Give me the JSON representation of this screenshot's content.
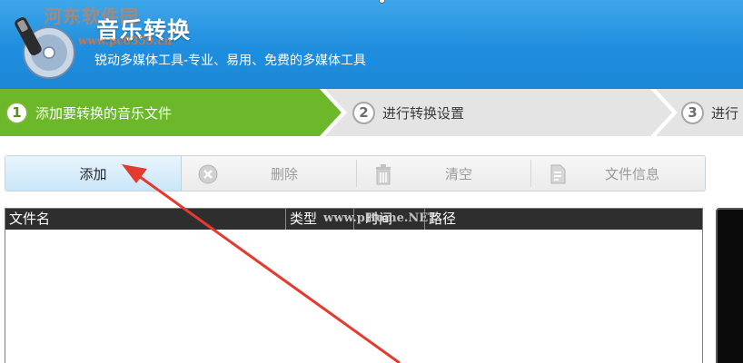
{
  "header": {
    "title": "音乐转换",
    "subtitle": "锐动多媒体工具-专业、易用、免费的多媒体工具",
    "watermark_site": "河东软件园",
    "watermark_url": "www.pc0359.cn",
    "bg_color": "#1f8ede"
  },
  "steps": [
    {
      "number": "1",
      "label": "添加要转换的音乐文件",
      "active": true
    },
    {
      "number": "2",
      "label": "进行转换设置",
      "active": false
    },
    {
      "number": "3",
      "label": "进行",
      "active": false
    }
  ],
  "toolbar": {
    "add_label": "添加",
    "delete_label": "删除",
    "clear_label": "清空",
    "info_label": "文件信息"
  },
  "file_list": {
    "columns": [
      "文件名",
      "类型",
      "时间",
      "路径"
    ],
    "header_watermark": "www.pHome.NET",
    "rows": []
  },
  "colors": {
    "active_step": "#6cb82a",
    "annotation_arrow": "#e53a2e"
  }
}
